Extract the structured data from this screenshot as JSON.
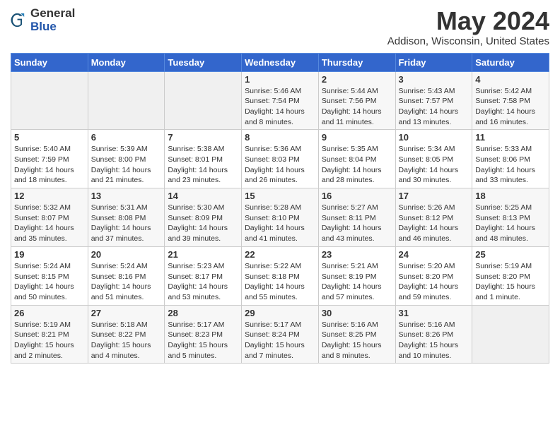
{
  "header": {
    "logo_general": "General",
    "logo_blue": "Blue",
    "month_title": "May 2024",
    "location": "Addison, Wisconsin, United States"
  },
  "weekdays": [
    "Sunday",
    "Monday",
    "Tuesday",
    "Wednesday",
    "Thursday",
    "Friday",
    "Saturday"
  ],
  "weeks": [
    [
      {
        "day": "",
        "content": ""
      },
      {
        "day": "",
        "content": ""
      },
      {
        "day": "",
        "content": ""
      },
      {
        "day": "1",
        "content": "Sunrise: 5:46 AM\nSunset: 7:54 PM\nDaylight: 14 hours\nand 8 minutes."
      },
      {
        "day": "2",
        "content": "Sunrise: 5:44 AM\nSunset: 7:56 PM\nDaylight: 14 hours\nand 11 minutes."
      },
      {
        "day": "3",
        "content": "Sunrise: 5:43 AM\nSunset: 7:57 PM\nDaylight: 14 hours\nand 13 minutes."
      },
      {
        "day": "4",
        "content": "Sunrise: 5:42 AM\nSunset: 7:58 PM\nDaylight: 14 hours\nand 16 minutes."
      }
    ],
    [
      {
        "day": "5",
        "content": "Sunrise: 5:40 AM\nSunset: 7:59 PM\nDaylight: 14 hours\nand 18 minutes."
      },
      {
        "day": "6",
        "content": "Sunrise: 5:39 AM\nSunset: 8:00 PM\nDaylight: 14 hours\nand 21 minutes."
      },
      {
        "day": "7",
        "content": "Sunrise: 5:38 AM\nSunset: 8:01 PM\nDaylight: 14 hours\nand 23 minutes."
      },
      {
        "day": "8",
        "content": "Sunrise: 5:36 AM\nSunset: 8:03 PM\nDaylight: 14 hours\nand 26 minutes."
      },
      {
        "day": "9",
        "content": "Sunrise: 5:35 AM\nSunset: 8:04 PM\nDaylight: 14 hours\nand 28 minutes."
      },
      {
        "day": "10",
        "content": "Sunrise: 5:34 AM\nSunset: 8:05 PM\nDaylight: 14 hours\nand 30 minutes."
      },
      {
        "day": "11",
        "content": "Sunrise: 5:33 AM\nSunset: 8:06 PM\nDaylight: 14 hours\nand 33 minutes."
      }
    ],
    [
      {
        "day": "12",
        "content": "Sunrise: 5:32 AM\nSunset: 8:07 PM\nDaylight: 14 hours\nand 35 minutes."
      },
      {
        "day": "13",
        "content": "Sunrise: 5:31 AM\nSunset: 8:08 PM\nDaylight: 14 hours\nand 37 minutes."
      },
      {
        "day": "14",
        "content": "Sunrise: 5:30 AM\nSunset: 8:09 PM\nDaylight: 14 hours\nand 39 minutes."
      },
      {
        "day": "15",
        "content": "Sunrise: 5:28 AM\nSunset: 8:10 PM\nDaylight: 14 hours\nand 41 minutes."
      },
      {
        "day": "16",
        "content": "Sunrise: 5:27 AM\nSunset: 8:11 PM\nDaylight: 14 hours\nand 43 minutes."
      },
      {
        "day": "17",
        "content": "Sunrise: 5:26 AM\nSunset: 8:12 PM\nDaylight: 14 hours\nand 46 minutes."
      },
      {
        "day": "18",
        "content": "Sunrise: 5:25 AM\nSunset: 8:13 PM\nDaylight: 14 hours\nand 48 minutes."
      }
    ],
    [
      {
        "day": "19",
        "content": "Sunrise: 5:24 AM\nSunset: 8:15 PM\nDaylight: 14 hours\nand 50 minutes."
      },
      {
        "day": "20",
        "content": "Sunrise: 5:24 AM\nSunset: 8:16 PM\nDaylight: 14 hours\nand 51 minutes."
      },
      {
        "day": "21",
        "content": "Sunrise: 5:23 AM\nSunset: 8:17 PM\nDaylight: 14 hours\nand 53 minutes."
      },
      {
        "day": "22",
        "content": "Sunrise: 5:22 AM\nSunset: 8:18 PM\nDaylight: 14 hours\nand 55 minutes."
      },
      {
        "day": "23",
        "content": "Sunrise: 5:21 AM\nSunset: 8:19 PM\nDaylight: 14 hours\nand 57 minutes."
      },
      {
        "day": "24",
        "content": "Sunrise: 5:20 AM\nSunset: 8:20 PM\nDaylight: 14 hours\nand 59 minutes."
      },
      {
        "day": "25",
        "content": "Sunrise: 5:19 AM\nSunset: 8:20 PM\nDaylight: 15 hours\nand 1 minute."
      }
    ],
    [
      {
        "day": "26",
        "content": "Sunrise: 5:19 AM\nSunset: 8:21 PM\nDaylight: 15 hours\nand 2 minutes."
      },
      {
        "day": "27",
        "content": "Sunrise: 5:18 AM\nSunset: 8:22 PM\nDaylight: 15 hours\nand 4 minutes."
      },
      {
        "day": "28",
        "content": "Sunrise: 5:17 AM\nSunset: 8:23 PM\nDaylight: 15 hours\nand 5 minutes."
      },
      {
        "day": "29",
        "content": "Sunrise: 5:17 AM\nSunset: 8:24 PM\nDaylight: 15 hours\nand 7 minutes."
      },
      {
        "day": "30",
        "content": "Sunrise: 5:16 AM\nSunset: 8:25 PM\nDaylight: 15 hours\nand 8 minutes."
      },
      {
        "day": "31",
        "content": "Sunrise: 5:16 AM\nSunset: 8:26 PM\nDaylight: 15 hours\nand 10 minutes."
      },
      {
        "day": "",
        "content": ""
      }
    ]
  ]
}
